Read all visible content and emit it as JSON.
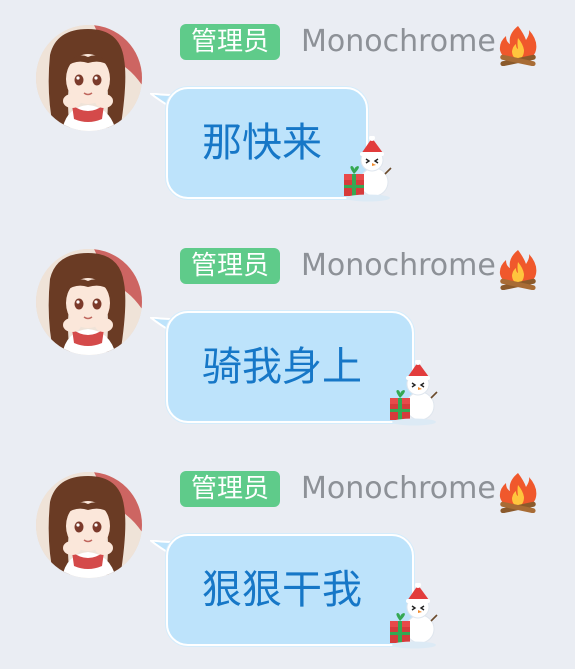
{
  "messages": [
    {
      "badge": "管理员",
      "username": "Monochrome",
      "text": "那快来"
    },
    {
      "badge": "管理员",
      "username": "Monochrome",
      "text": "骑我身上"
    },
    {
      "badge": "管理员",
      "username": "Monochrome",
      "text": "狠狠干我"
    }
  ],
  "icons": {
    "avatar": "anime-girl-avatar",
    "title_emoji": "fire-icon",
    "bubble_decoration": "snowman-gift-icon"
  },
  "colors": {
    "background": "#eaedf3",
    "badge": "#5fcb8a",
    "bubble": "#bde3fb",
    "bubble_text": "#1677c7",
    "username": "#8d9197"
  }
}
